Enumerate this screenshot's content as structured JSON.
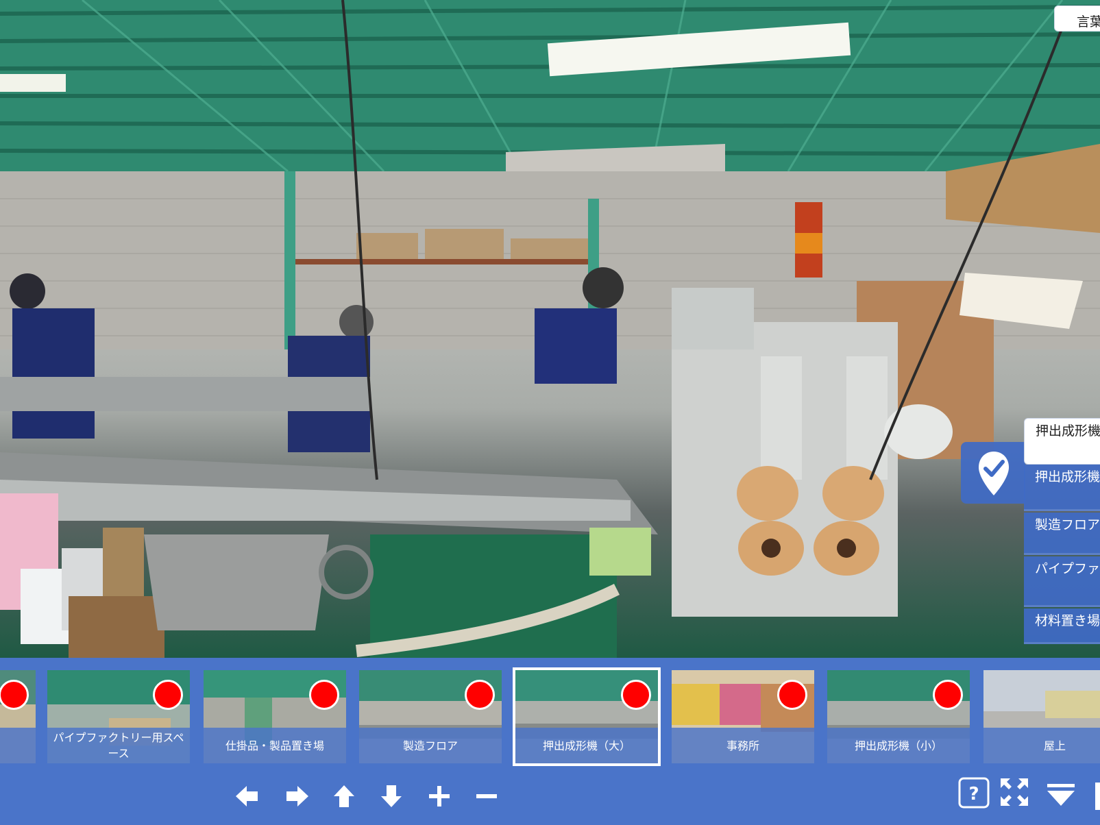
{
  "language_button": {
    "label": "言葉"
  },
  "scene_menu": {
    "items": [
      {
        "label": "押出成形機（大）",
        "active": true
      },
      {
        "label": "押出成形機（小）",
        "active": false
      },
      {
        "label": "製造フロア",
        "active": false
      },
      {
        "label": "パイプファクトリー用スペース",
        "active": false
      },
      {
        "label": "材料置き場",
        "active": false
      }
    ],
    "pin_icon": "location-check-icon"
  },
  "thumbnails": [
    {
      "label": "",
      "selected": false
    },
    {
      "label": "パイプファクトリー用スペース",
      "selected": false
    },
    {
      "label": "仕掛品・製品置き場",
      "selected": false
    },
    {
      "label": "製造フロア",
      "selected": false
    },
    {
      "label": "押出成形機（大）",
      "selected": true
    },
    {
      "label": "事務所",
      "selected": false
    },
    {
      "label": "押出成形機（小）",
      "selected": false
    },
    {
      "label": "屋上",
      "selected": false
    }
  ],
  "controls": [
    {
      "name": "arrow-left-icon"
    },
    {
      "name": "arrow-right-icon"
    },
    {
      "name": "arrow-up-icon"
    },
    {
      "name": "arrow-down-icon"
    },
    {
      "name": "plus-icon"
    },
    {
      "name": "minus-icon"
    },
    {
      "name": "help-icon",
      "label": "?"
    },
    {
      "name": "fullscreen-icon"
    },
    {
      "name": "collapse-triangle-icon"
    }
  ],
  "colors": {
    "bar": "#4a74c9",
    "hotspot": "#ff0000",
    "menu": "#3f6bc5"
  }
}
